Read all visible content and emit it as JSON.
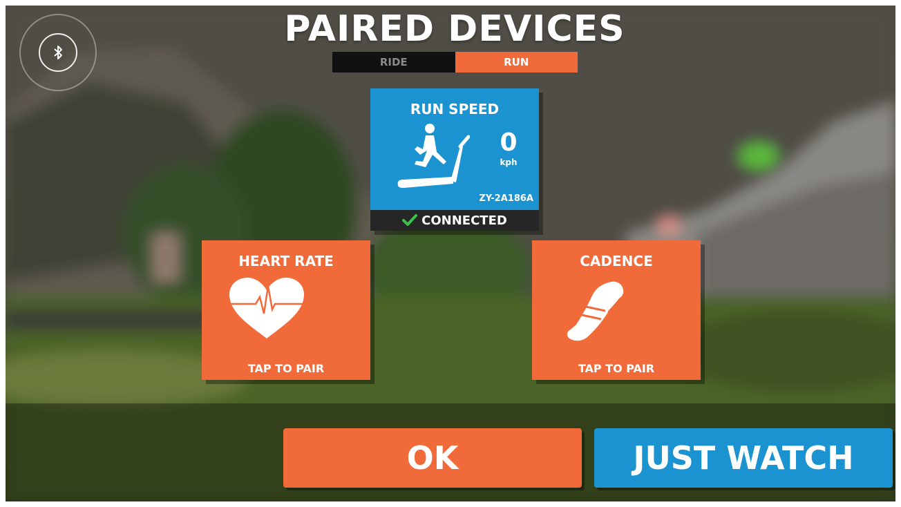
{
  "header": {
    "title": "PAIRED DEVICES",
    "tabs": [
      {
        "label": "RIDE",
        "active": false
      },
      {
        "label": "RUN",
        "active": true
      }
    ]
  },
  "bluetooth": {
    "icon": "bluetooth-icon"
  },
  "devices": {
    "run_speed": {
      "title": "RUN SPEED",
      "value": "0",
      "unit": "kph",
      "device_id": "ZY-2A186A",
      "status": "CONNECTED",
      "icon": "treadmill-runner-icon"
    },
    "heart_rate": {
      "title": "HEART RATE",
      "action": "TAP TO PAIR",
      "icon": "heart-pulse-icon"
    },
    "cadence": {
      "title": "CADENCE",
      "action": "TAP TO PAIR",
      "icon": "running-shoe-icon"
    }
  },
  "buttons": {
    "ok": "OK",
    "just_watch": "JUST WATCH"
  },
  "colors": {
    "orange": "#f06a3a",
    "blue": "#1c93d1",
    "dark": "#262626",
    "check_green": "#3cc24a"
  }
}
